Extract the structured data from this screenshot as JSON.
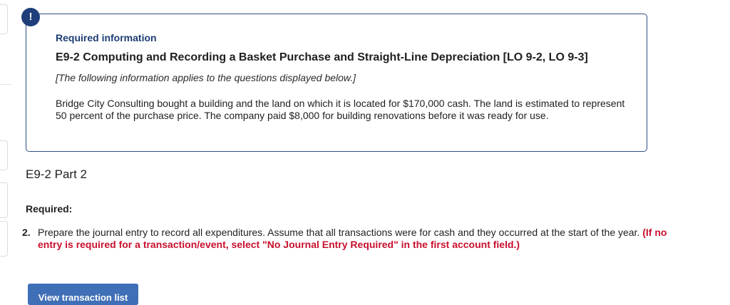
{
  "alert_icon": {
    "glyph": "!",
    "icon": "alert-icon",
    "color": "#1f3f7a"
  },
  "info_box": {
    "title": "Required information",
    "heading": "E9-2 Computing and Recording a Basket Purchase and Straight-Line Depreciation [LO 9-2, LO 9-3]",
    "note": "[The following information applies to the questions displayed below.]",
    "body": "Bridge City Consulting bought a building and the land on which it is located for $170,000 cash. The land is estimated to represent 50 percent of the purchase price. The company paid $8,000 for building renovations before it was ready for use.",
    "border_color": "#2f4f86"
  },
  "part": {
    "heading": "E9-2 Part 2"
  },
  "required": {
    "label": "Required:",
    "items": [
      {
        "number": "2.",
        "text": "Prepare the journal entry to record all expenditures. Assume that all transactions were for cash and they occurred at the start of the year.",
        "note": "(If no entry is required for a transaction/event, select \"No Journal Entry Required\" in the first account field.)"
      }
    ],
    "note_color": "#c8102e"
  },
  "actions": {
    "view_transaction_list": "View transaction list",
    "button_color": "#3f6fb6"
  }
}
